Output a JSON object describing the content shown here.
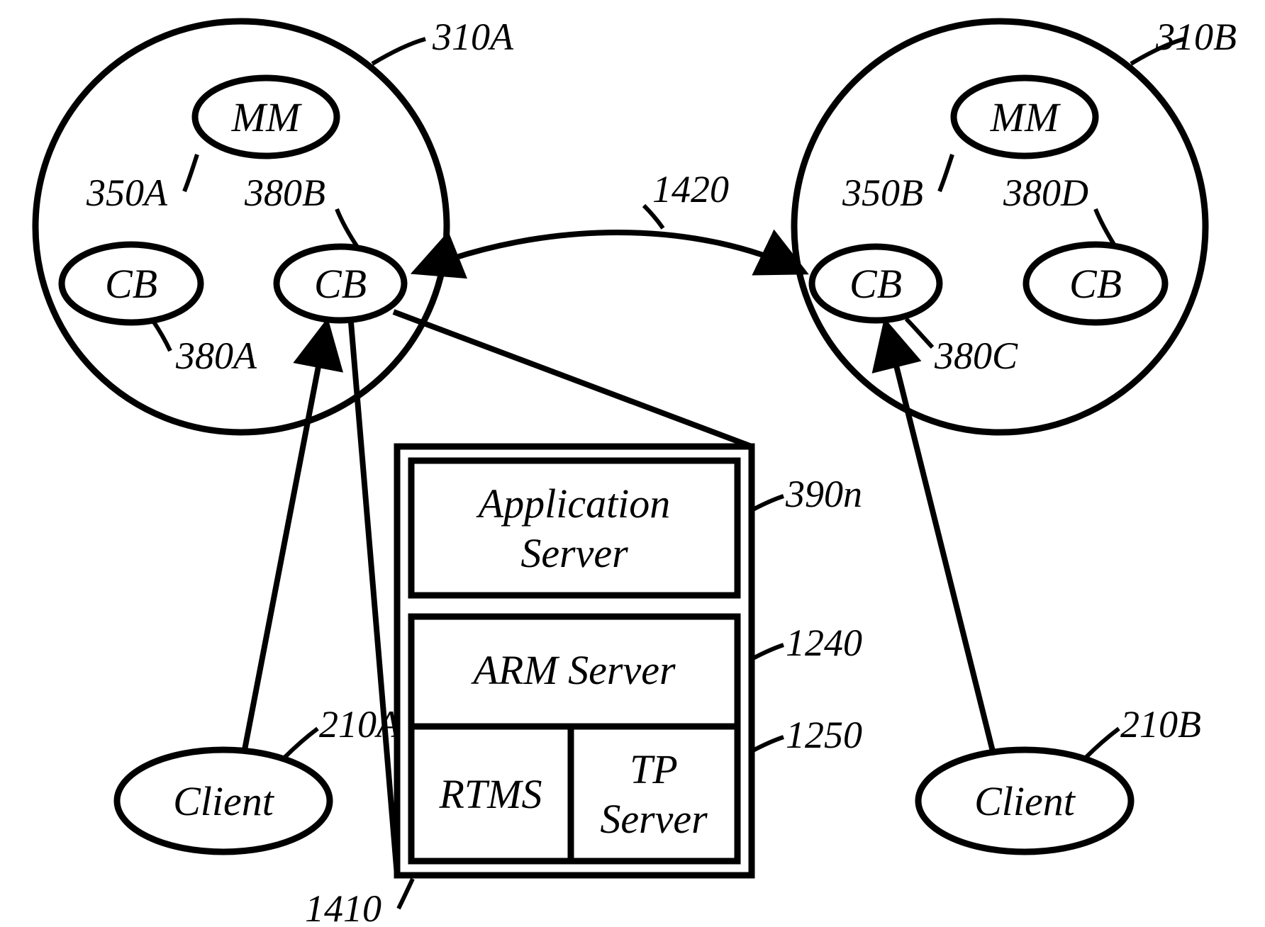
{
  "clusterA": {
    "ref": "310A",
    "mm": {
      "text": "MM",
      "ref": "350A"
    },
    "cb1": {
      "text": "CB",
      "ref": "380A"
    },
    "cb2": {
      "text": "CB",
      "ref": "380B"
    }
  },
  "clusterB": {
    "ref": "310B",
    "mm": {
      "text": "MM",
      "ref": "350B"
    },
    "cb1": {
      "text": "CB",
      "ref": "380C"
    },
    "cb2": {
      "text": "CB",
      "ref": "380D"
    }
  },
  "link": {
    "ref": "1420"
  },
  "stack": {
    "ref": "1410",
    "app": {
      "text1": "Application",
      "text2": "Server",
      "ref": "390n"
    },
    "arm": {
      "text": "ARM Server",
      "ref": "1240"
    },
    "rtms": {
      "text": "RTMS"
    },
    "tp": {
      "text1": "TP",
      "text2": "Server",
      "ref": "1250"
    }
  },
  "clientA": {
    "text": "Client",
    "ref": "210A"
  },
  "clientB": {
    "text": "Client",
    "ref": "210B"
  }
}
